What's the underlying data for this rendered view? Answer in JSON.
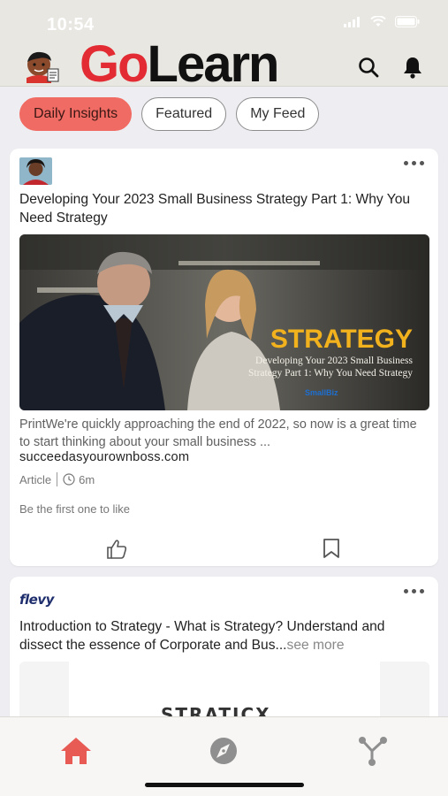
{
  "status_bar": {
    "time": "10:54"
  },
  "header": {
    "brand_go": "Go",
    "brand_learn": "Learn",
    "icons": [
      "search-icon",
      "bell-icon"
    ]
  },
  "tabs": [
    {
      "label": "Daily Insights",
      "active": true
    },
    {
      "label": "Featured",
      "active": false
    },
    {
      "label": "My Feed",
      "active": false
    }
  ],
  "feed": [
    {
      "title": "Developing Your 2023 Small Business Strategy Part 1: Why You Need Strategy",
      "image": {
        "headline": "STRATEGY",
        "caption_line1": "Developing Your 2023 Small Business",
        "caption_line2": "Strategy Part 1: Why You Need Strategy",
        "brand": "SmallBiz"
      },
      "excerpt": "PrintWe're quickly approaching the end of 2022, so now is a great time to start thinking about your small business ...",
      "source": "succeedasyourownboss.com",
      "type": "Article",
      "duration": "6m",
      "likes_text": "Be the first one to like"
    },
    {
      "publisher": "flevy",
      "title": "Introduction to Strategy - What is Strategy? Understand and dissect the essence of Corporate and Bus...",
      "see_more": "see more",
      "preview_text": "STRATICX"
    }
  ],
  "bottom_nav": [
    "home-icon",
    "compass-icon",
    "network-icon"
  ],
  "colors": {
    "accent": "#e22b32",
    "active_tab": "#f06b63",
    "home_active": "#e85b55",
    "nav_inactive": "#8f8f8f"
  }
}
